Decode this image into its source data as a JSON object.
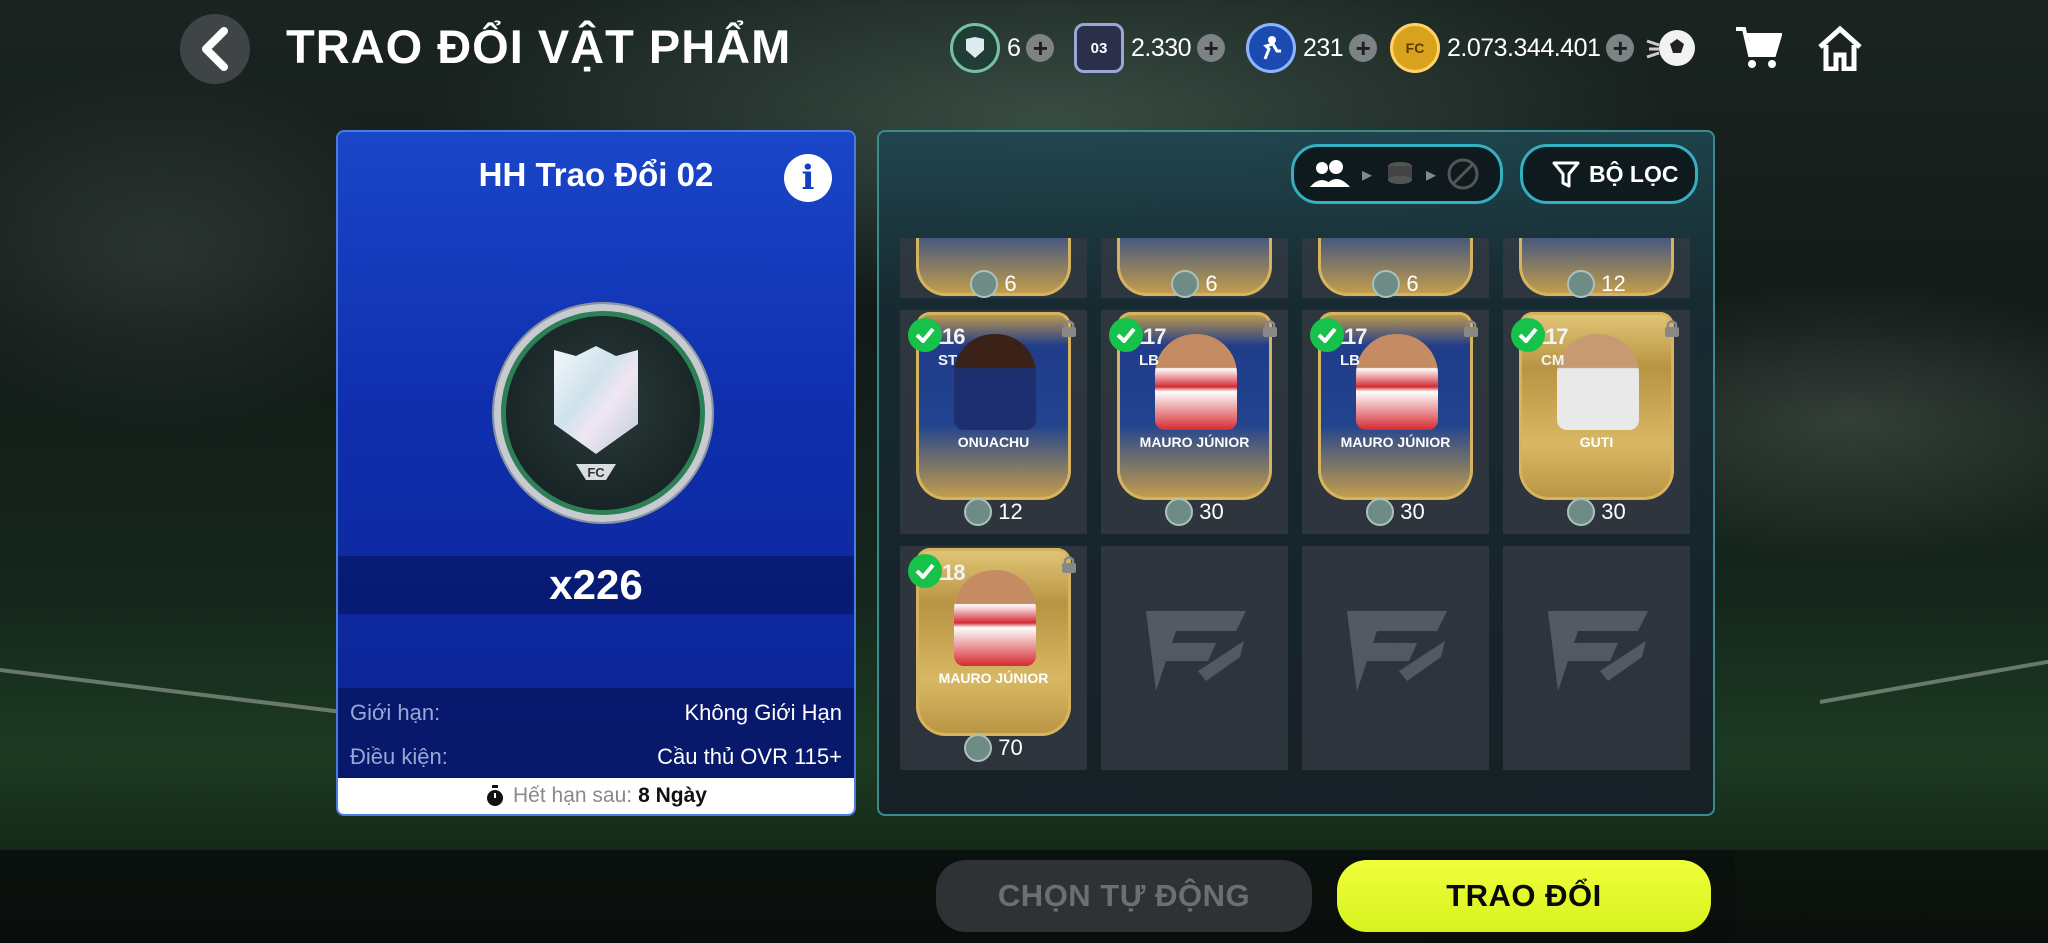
{
  "header": {
    "title": "TRAO ĐỔI VẬT PHẨM",
    "currencies": [
      {
        "icon": "shield-token-icon",
        "value": "6"
      },
      {
        "icon": "card-03-icon",
        "value": "2.330"
      },
      {
        "icon": "player-token-icon",
        "value": "231"
      },
      {
        "icon": "fc-coin-icon",
        "value": "2.073.344.401"
      }
    ]
  },
  "offer": {
    "title": "HH Trao Đổi 02",
    "quantity": "x226",
    "limit_label": "Giới hạn:",
    "limit_value": "Không Giới Hạn",
    "condition_label": "Điều kiện:",
    "condition_value": "Cầu thủ OVR 115+",
    "expire_label": "Hết hạn sau:",
    "expire_value": "8 Ngày"
  },
  "filter": {
    "label": "BỘ LỌC"
  },
  "top_row_costs": [
    "6",
    "6",
    "6",
    "12"
  ],
  "players": [
    {
      "ovr": "116",
      "pos": "ST",
      "name": "ONUACHU",
      "cost": "12",
      "selected": true,
      "kit": "#1d2f6f",
      "skin": "#3a2218"
    },
    {
      "ovr": "117",
      "pos": "LB",
      "name": "MAURO JÚNIOR",
      "cost": "30",
      "selected": true,
      "kit": "#d42a32",
      "skin": "#c58c64"
    },
    {
      "ovr": "117",
      "pos": "LB",
      "name": "MAURO JÚNIOR",
      "cost": "30",
      "selected": true,
      "kit": "#d42a32",
      "skin": "#c58c64"
    },
    {
      "ovr": "117",
      "pos": "CM",
      "name": "GUTI",
      "cost": "30",
      "selected": true,
      "kit": "#e9e9e9",
      "skin": "#c89a72"
    },
    {
      "ovr": "118",
      "pos": "",
      "name": "MAURO JÚNIOR",
      "cost": "70",
      "selected": true,
      "kit": "#d42a32",
      "skin": "#c58c64"
    }
  ],
  "buttons": {
    "auto": "CHỌN TỰ ĐỘNG",
    "trade": "TRAO ĐỔI"
  },
  "colors": {
    "accent_yellow": "#e4f52a",
    "panel_blue": "#1a46c8",
    "check_green": "#17c24a",
    "filter_border": "#34b0c0"
  }
}
